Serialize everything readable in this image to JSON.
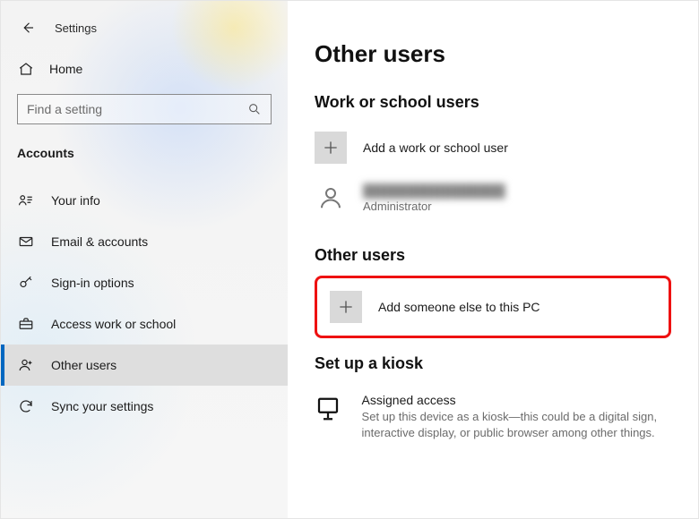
{
  "window": {
    "title": "Settings"
  },
  "sidebar": {
    "home_label": "Home",
    "search_placeholder": "Find a setting",
    "section_label": "Accounts",
    "items": [
      {
        "label": "Your info"
      },
      {
        "label": "Email & accounts"
      },
      {
        "label": "Sign-in options"
      },
      {
        "label": "Access work or school"
      },
      {
        "label": "Other users"
      },
      {
        "label": "Sync your settings"
      }
    ]
  },
  "main": {
    "title": "Other users",
    "section_work": {
      "heading": "Work or school users",
      "add_label": "Add a work or school user",
      "existing_user": {
        "name": "████████████████",
        "role": "Administrator"
      }
    },
    "section_other": {
      "heading": "Other users",
      "add_label": "Add someone else to this PC"
    },
    "section_kiosk": {
      "heading": "Set up a kiosk",
      "item_title": "Assigned access",
      "item_desc": "Set up this device as a kiosk—this could be a digital sign, interactive display, or public browser among other things."
    }
  }
}
